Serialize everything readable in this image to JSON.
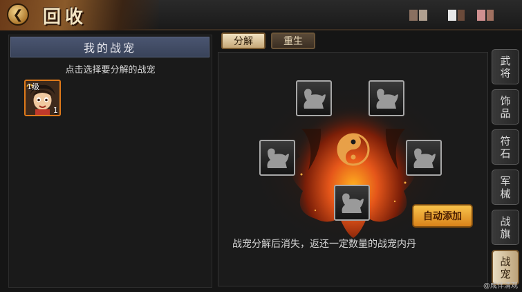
{
  "header": {
    "title": "回收",
    "back_icon": "back-arrow-icon",
    "obscured_colors": [
      "#8a7060",
      "#b0a090",
      "#e8e8e8",
      "#6a4a3a",
      "#d09090",
      "#a07060"
    ]
  },
  "left_panel": {
    "title": "我的战宠",
    "hint": "点击选择要分解的战宠",
    "pet": {
      "level": "1级",
      "count": "1"
    }
  },
  "tabs": [
    {
      "label": "分解",
      "active": true
    },
    {
      "label": "重生",
      "active": false
    }
  ],
  "center": {
    "slot_icon": "pet-silhouette-icon",
    "emblem_icon": "yin-yang-icon",
    "auto_add_label": "自动添加",
    "description": "战宠分解后消失，返还一定数量的战宠内丹"
  },
  "side_tabs": [
    {
      "label": "武将",
      "active": false
    },
    {
      "label": "饰品",
      "active": false
    },
    {
      "label": "符石",
      "active": false
    },
    {
      "label": "军械",
      "active": false
    },
    {
      "label": "战旗",
      "active": false
    },
    {
      "label": "战宠",
      "active": true
    }
  ],
  "watermark": "@成伴清观",
  "colors": {
    "accent": "#e07a1a",
    "button": "#f0a830",
    "flame": "#d2420f"
  }
}
